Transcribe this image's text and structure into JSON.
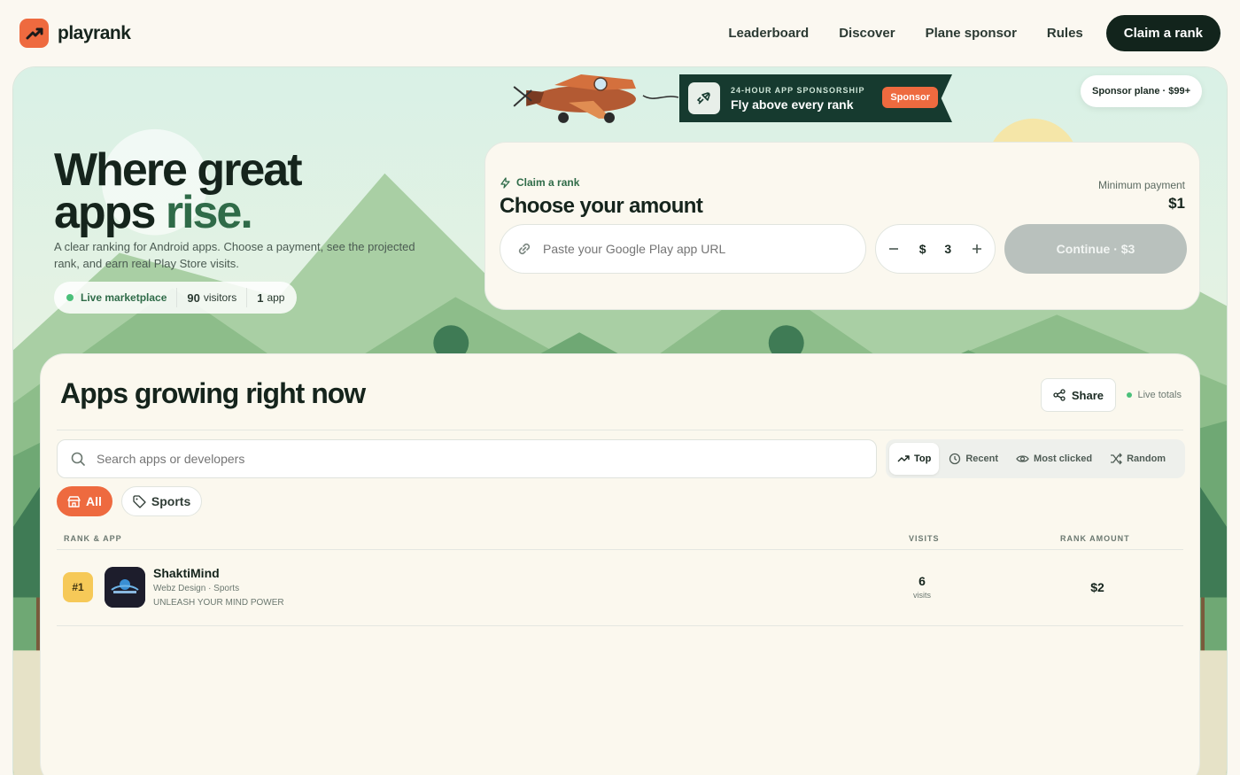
{
  "brand": {
    "name": "playrank",
    "accent": "#ee6a3f"
  },
  "nav": {
    "links": [
      "Leaderboard",
      "Discover",
      "Plane sponsor",
      "Rules"
    ],
    "cta": "Claim a rank"
  },
  "banner": {
    "kicker": "24-HOUR APP SPONSORSHIP",
    "title": "Fly above every rank",
    "badge": "Sponsor",
    "pill": "Sponsor plane · $99+"
  },
  "hero": {
    "headline_1": "Where great",
    "headline_2a": "apps",
    "headline_2b": "rise.",
    "subline": "A clear ranking for Android apps. Choose a payment, see the projected rank, and earn real Play Store visits.",
    "stats": {
      "live_label": "Live marketplace",
      "visitors_n": "90",
      "visitors_label": "visitors",
      "apps_n": "1",
      "apps_label": "app"
    }
  },
  "claim": {
    "kicker": "Claim a rank",
    "title": "Choose your amount",
    "min_label": "Minimum payment",
    "min_value": "$1",
    "url_placeholder": "Paste your Google Play app URL",
    "currency": "$",
    "amount": "3",
    "continue_label": "Continue · $3"
  },
  "list": {
    "title": "Apps growing right now",
    "share_label": "Share",
    "live_totals": "Live totals",
    "search_placeholder": "Search apps or developers",
    "sort_options": [
      "Top",
      "Recent",
      "Most clicked",
      "Random"
    ],
    "active_sort": "Top",
    "chips": [
      "All",
      "Sports"
    ],
    "columns": [
      "RANK & APP",
      "VISITS",
      "RANK AMOUNT"
    ],
    "rows": [
      {
        "rank": "#1",
        "name": "ShaktiMind",
        "meta": "Webz Design · Sports",
        "tagline": "UNLEASH YOUR MIND POWER",
        "visits": "6",
        "visits_label": "visits",
        "amount": "$2"
      }
    ]
  }
}
